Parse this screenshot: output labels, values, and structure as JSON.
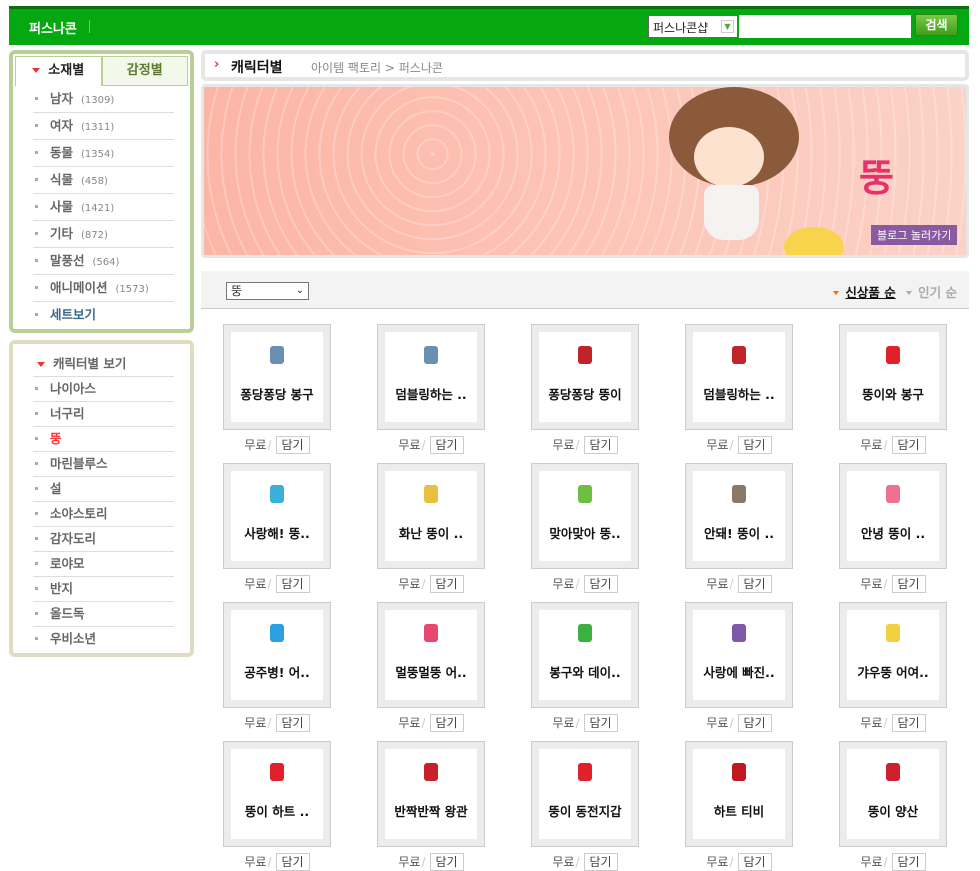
{
  "header": {
    "brand": "퍼스나콘",
    "search_scope": "퍼스나콘샵",
    "search_value": "",
    "search_button": "검색"
  },
  "sidebar": {
    "tabs": [
      {
        "label": "소재별",
        "active": true
      },
      {
        "label": "감정별",
        "active": false
      }
    ],
    "categories": [
      {
        "label": "남자",
        "count": "(1309)"
      },
      {
        "label": "여자",
        "count": "(1311)"
      },
      {
        "label": "동물",
        "count": "(1354)"
      },
      {
        "label": "식물",
        "count": "(458)"
      },
      {
        "label": "사물",
        "count": "(1421)"
      },
      {
        "label": "기타",
        "count": "(872)"
      },
      {
        "label": "말풍선",
        "count": "(564)"
      },
      {
        "label": "애니메이션",
        "count": "(1573)"
      }
    ],
    "set_view": "세트보기",
    "character_header": "캐릭터별 보기",
    "characters": [
      "나이아스",
      "너구리",
      "뚱",
      "마린블루스",
      "설",
      "소야스토리",
      "감자도리",
      "로야모",
      "반지",
      "올드독",
      "우비소년"
    ],
    "selected_character": "뚱"
  },
  "breadcrumb": {
    "title": "캐릭터별",
    "path": "아이템 팩토리 > 퍼스나콘"
  },
  "banner": {
    "logo": "뚱",
    "blog_button": "블로그 놀러가기"
  },
  "toolbar": {
    "character_select": "뚱",
    "sort_new": "신상품 순",
    "sort_popular": "인기 순"
  },
  "item_actions": {
    "price": "무료",
    "add": "담기"
  },
  "items": [
    {
      "name": "퐁당퐁당 봉구",
      "color": "#6a8fb0"
    },
    {
      "name": "덤블링하는 ..",
      "color": "#6a8fb0"
    },
    {
      "name": "퐁당퐁당 뚱이",
      "color": "#c0242a"
    },
    {
      "name": "덤블링하는 ..",
      "color": "#c0242a"
    },
    {
      "name": "뚱이와 봉구",
      "color": "#e0202a"
    },
    {
      "name": "사랑해! 뚱..",
      "color": "#3ab0d8"
    },
    {
      "name": "화난 뚱이 ..",
      "color": "#e8c040"
    },
    {
      "name": "맞아맞아 뚱..",
      "color": "#6cbf40"
    },
    {
      "name": "안돼! 뚱이 ..",
      "color": "#8a7868"
    },
    {
      "name": "안녕 뚱이 ..",
      "color": "#f07090"
    },
    {
      "name": "공주병! 어..",
      "color": "#2aa0e0"
    },
    {
      "name": "멀뚱멀뚱 어..",
      "color": "#e84870"
    },
    {
      "name": "봉구와 데이..",
      "color": "#3cb040"
    },
    {
      "name": "사랑에 빠진..",
      "color": "#8058a8"
    },
    {
      "name": "갸우뚱 어여..",
      "color": "#f0d040"
    },
    {
      "name": "뚱이 하트 ..",
      "color": "#e0202a"
    },
    {
      "name": "반짝반짝 왕관",
      "color": "#c8202a"
    },
    {
      "name": "뚱이 동전지갑",
      "color": "#e0202a"
    },
    {
      "name": "하트 티비",
      "color": "#c01820"
    },
    {
      "name": "뚱이 양산",
      "color": "#d02030"
    }
  ]
}
